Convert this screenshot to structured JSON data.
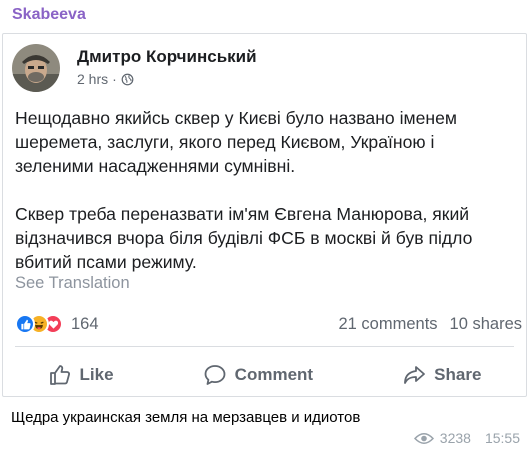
{
  "channel": {
    "name": "Skabeeva",
    "accent": "#8a63c6"
  },
  "post": {
    "author": "Дмитро Корчинський",
    "time": "2 hrs",
    "separator": "·",
    "privacy_icon": "globe-icon",
    "paragraph1": "Нещодавно якийсь сквер у Києві було названо іменем\nшеремета, заслуги, якого перед Києвом, Україною і\nзеленими насадженнями сумнівні.",
    "paragraph2": "Сквер треба переназвати ім'ям Євгена Манюрова, який\nвідзначився вчора біля будівлі ФСБ в москві й був підло\nвбитий псами режиму.",
    "see_translation": "See Translation",
    "reactions": {
      "icons": [
        "like-icon",
        "haha-icon",
        "love-icon"
      ],
      "count": "164"
    },
    "comments": "21 comments",
    "shares": "10 shares",
    "actions": {
      "like": "Like",
      "comment": "Comment",
      "share": "Share"
    }
  },
  "message": {
    "caption": "Щедра украинская земля на мерзавцев и идиотов",
    "views": "3238",
    "time": "15:55"
  }
}
